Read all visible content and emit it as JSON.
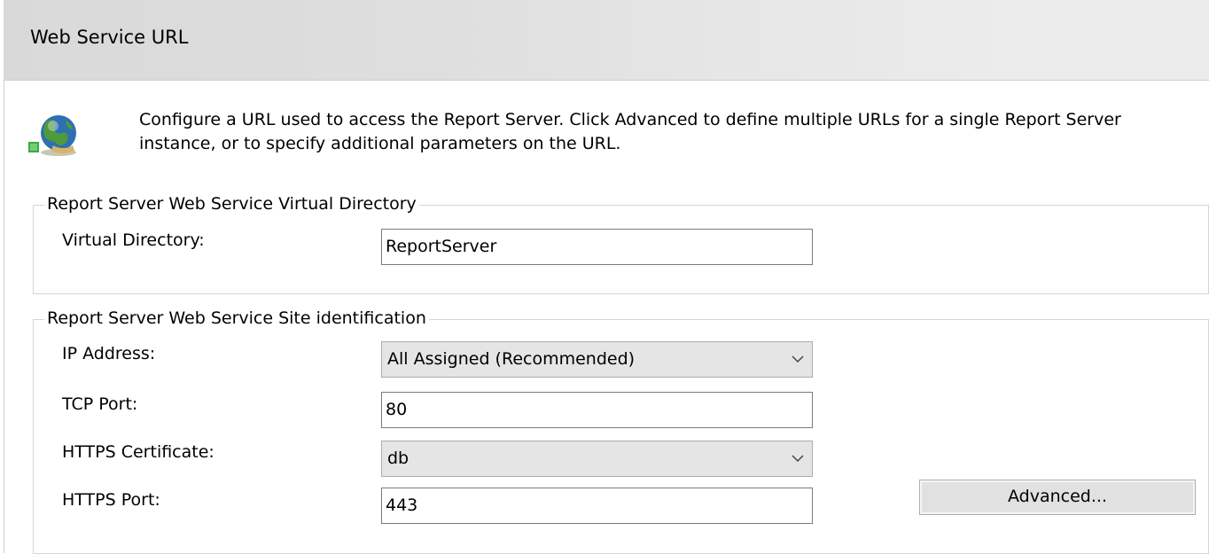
{
  "header": {
    "title": "Web Service URL"
  },
  "intro": {
    "icon": "globe-network-icon",
    "line1": "Configure a URL used to access the Report Server.  Click Advanced to define multiple URLs for a single Report Server",
    "line2": "instance, or to specify additional parameters on the URL."
  },
  "virtual_directory_group": {
    "legend": "Report Server Web Service Virtual Directory",
    "virtual_directory_label": "Virtual Directory:",
    "virtual_directory_value": "ReportServer"
  },
  "site_identification_group": {
    "legend": "Report Server Web Service Site identification",
    "ip_address_label": "IP Address:",
    "ip_address_value": "All Assigned (Recommended)",
    "tcp_port_label": "TCP Port:",
    "tcp_port_value": "80",
    "https_certificate_label": "HTTPS Certificate:",
    "https_certificate_value": "db",
    "https_port_label": "HTTPS Port:",
    "https_port_value": "443",
    "advanced_button_label": "Advanced..."
  },
  "colors": {
    "header_background": "#dedede",
    "group_border": "#d6d6d6",
    "combo_background": "#e5e5e5",
    "button_background": "#e1e1e1"
  }
}
